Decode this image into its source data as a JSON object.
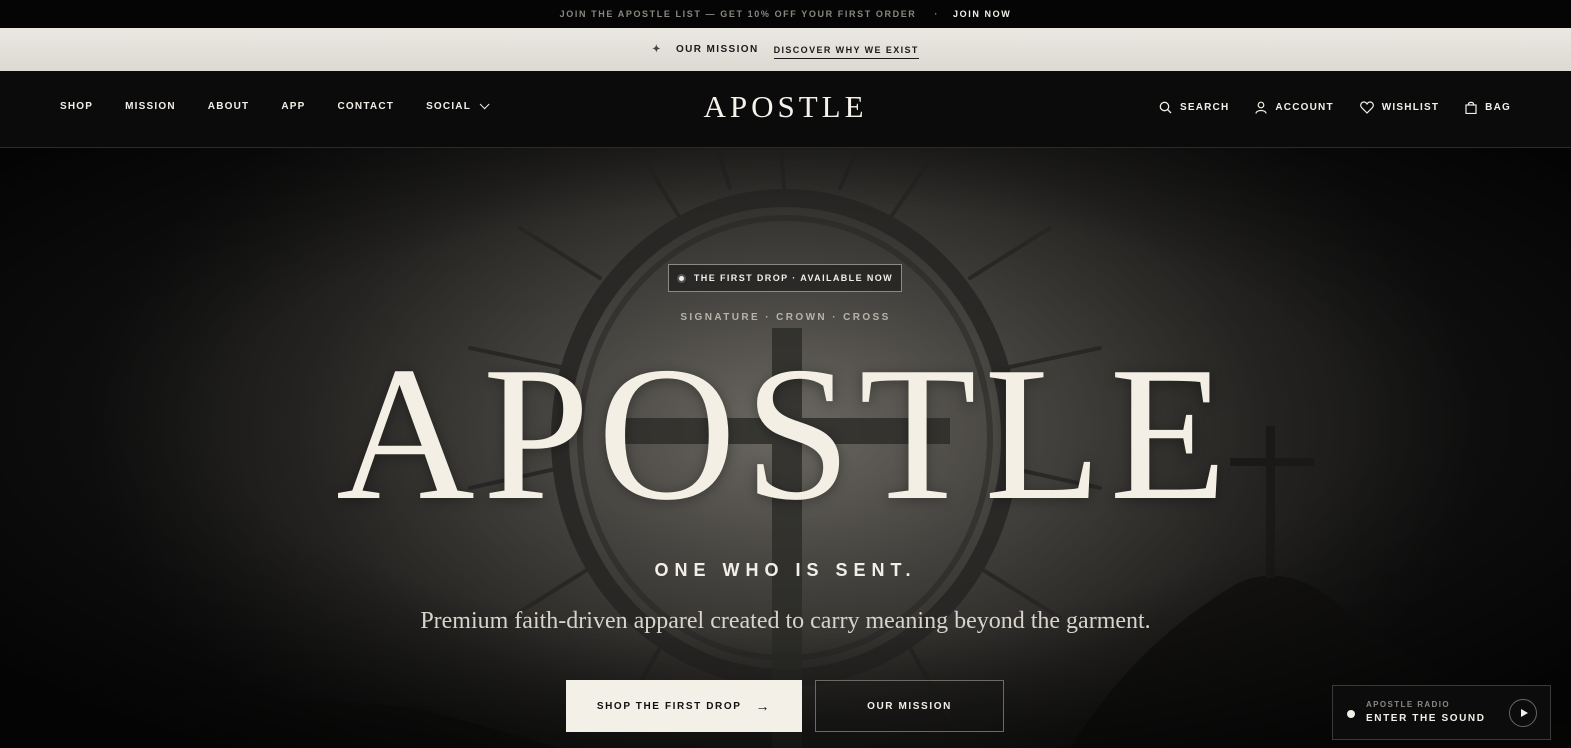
{
  "announcement": {
    "promo": "JOIN THE APOSTLE LIST — GET 10% OFF YOUR FIRST ORDER",
    "separator": "·",
    "join": "JOIN NOW"
  },
  "mission_strip": {
    "star": "✦",
    "label": "OUR MISSION",
    "link": "DISCOVER WHY WE EXIST"
  },
  "nav": {
    "left": [
      "SHOP",
      "MISSION",
      "ABOUT",
      "APP",
      "CONTACT",
      "SOCIAL"
    ],
    "logo": "APOSTLE",
    "right": [
      {
        "label": "SEARCH",
        "icon": "search-icon"
      },
      {
        "label": "ACCOUNT",
        "icon": "account-icon"
      },
      {
        "label": "WISHLIST",
        "icon": "heart-icon"
      },
      {
        "label": "BAG",
        "icon": "bag-icon"
      }
    ]
  },
  "hero": {
    "badge": "THE FIRST DROP · AVAILABLE NOW",
    "kicker": "SIGNATURE · CROWN · CROSS",
    "title": "APOSTLE",
    "subtitle": "ONE WHO IS SENT.",
    "tagline": "Premium faith-driven apparel created to carry meaning beyond the garment.",
    "primary_button": "SHOP THE FIRST DROP",
    "primary_arrow": "→",
    "secondary_button": "OUR MISSION"
  },
  "radio": {
    "label": "APOSTLE RADIO",
    "title": "ENTER THE SOUND"
  },
  "colors": {
    "background": "#0b0b0b",
    "cream": "#f3f0e8",
    "strip": "#e6e3dd"
  }
}
